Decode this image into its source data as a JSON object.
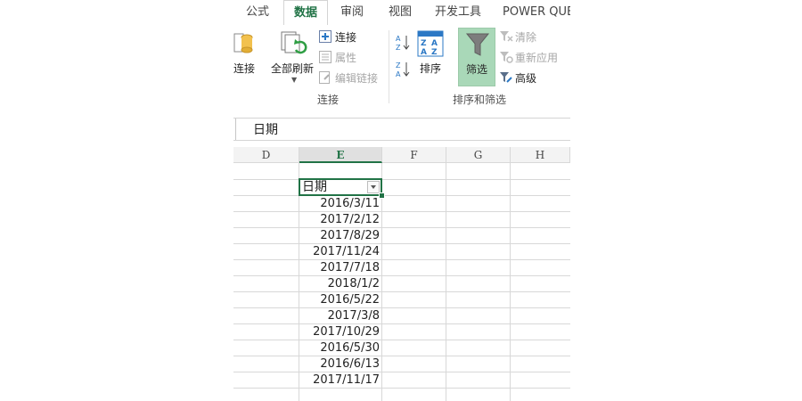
{
  "tabs": [
    "公式",
    "数据",
    "审阅",
    "视图",
    "开发工具",
    "POWER QUE"
  ],
  "ribbon": {
    "partial_connect": "连接",
    "refresh_all": "全部刷新",
    "connections": "连接",
    "properties": "属性",
    "edit_links": "编辑链接",
    "group_connections": "连接",
    "sort": "排序",
    "filter": "筛选",
    "clear": "清除",
    "reapply": "重新应用",
    "advanced": "高级",
    "group_sort_filter": "排序和筛选"
  },
  "formula_bar": {
    "value": "日期"
  },
  "columns": [
    "D",
    "E",
    "F",
    "G",
    "H"
  ],
  "header_cell": "日期",
  "dates": [
    "2016/3/11",
    "2017/2/12",
    "2017/8/29",
    "2017/11/24",
    "2017/7/18",
    "2018/1/2",
    "2016/5/22",
    "2017/3/8",
    "2017/10/29",
    "2016/5/30",
    "2016/6/13",
    "2017/11/17"
  ],
  "colors": {
    "accent": "#217346",
    "filter_active": "#a9d8b8"
  }
}
